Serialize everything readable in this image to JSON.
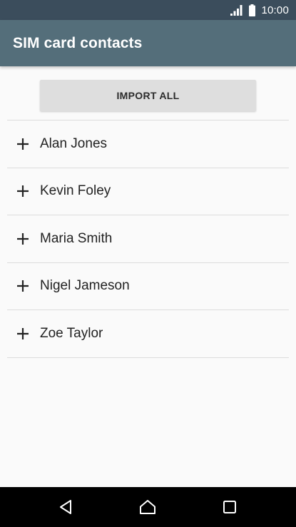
{
  "status_bar": {
    "time": "10:00",
    "icons": [
      "signal-icon",
      "battery-icon"
    ]
  },
  "app_bar": {
    "title": "SIM card contacts"
  },
  "import_button": {
    "label": "IMPORT ALL"
  },
  "contacts": [
    {
      "name": "Alan Jones",
      "icon": "plus-icon"
    },
    {
      "name": "Kevin Foley",
      "icon": "plus-icon"
    },
    {
      "name": "Maria Smith",
      "icon": "plus-icon"
    },
    {
      "name": "Nigel Jameson",
      "icon": "plus-icon"
    },
    {
      "name": "Zoe Taylor",
      "icon": "plus-icon"
    }
  ],
  "nav_bar": {
    "icons": [
      "back-icon",
      "home-icon",
      "recents-icon"
    ]
  },
  "colors": {
    "status_bar": "#3b4d5c",
    "app_bar": "#546e7a",
    "background": "#fafafa",
    "button": "#dedede"
  }
}
